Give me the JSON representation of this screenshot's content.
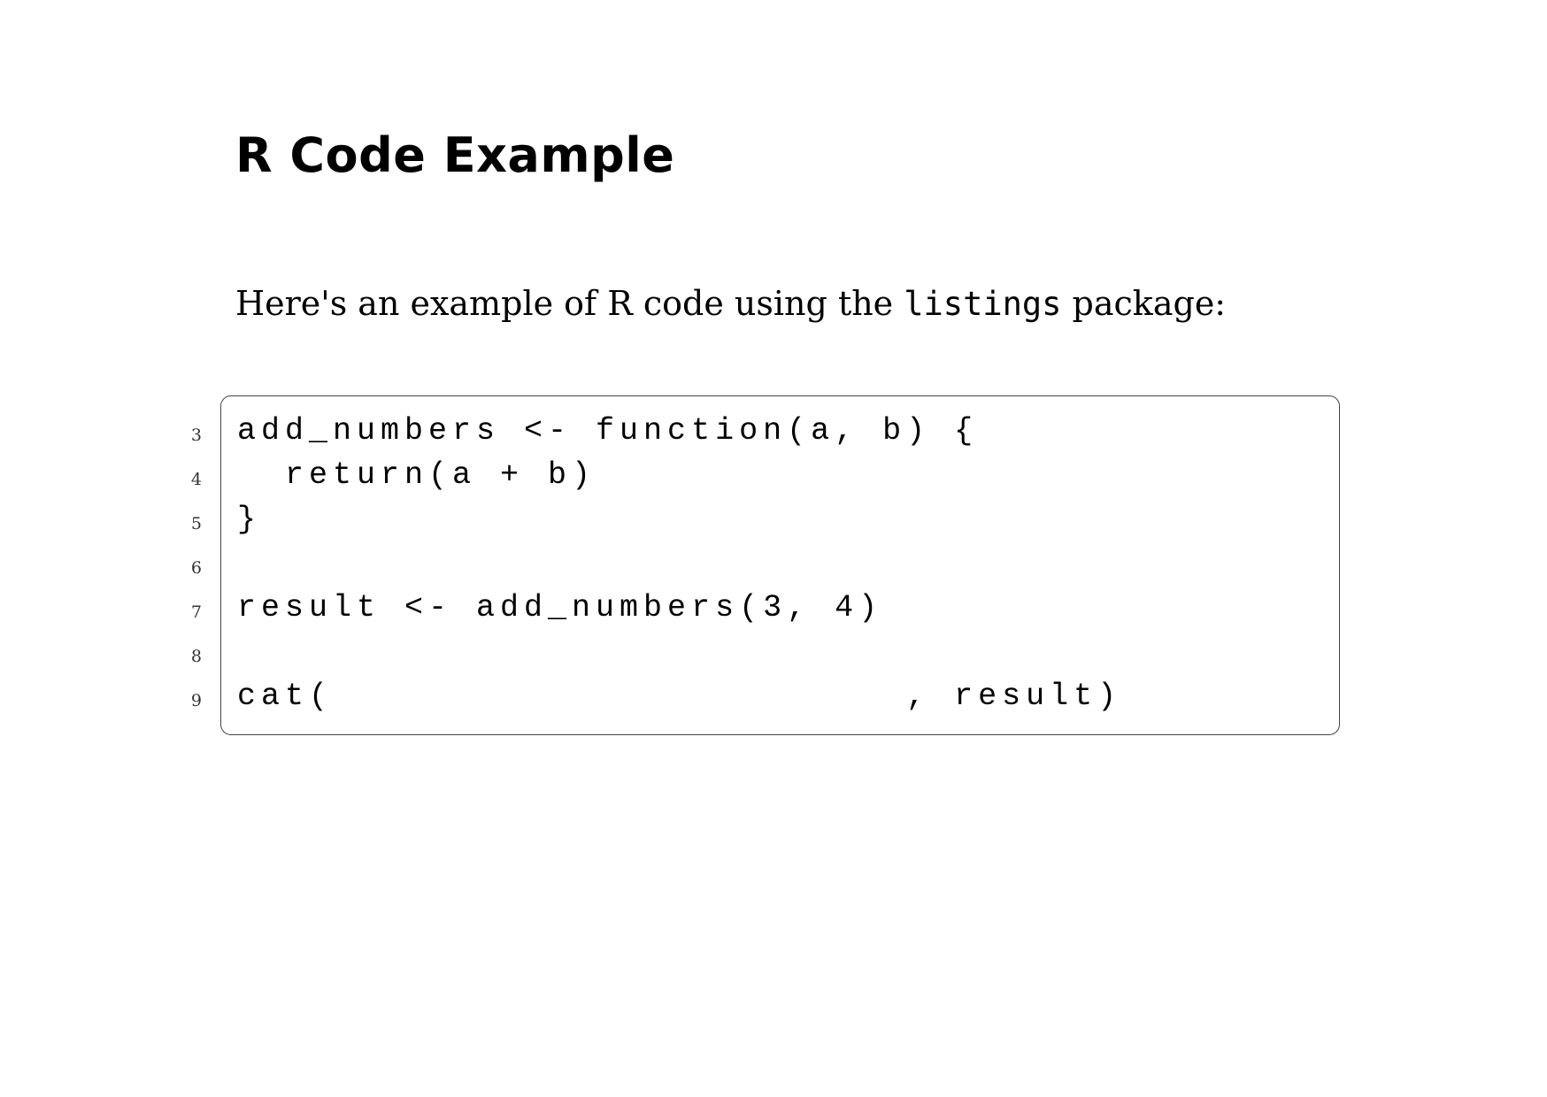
{
  "title": "R Code Example",
  "intro": {
    "before": "Here's an example of R code using the ",
    "package": "listings",
    "after": " package:"
  },
  "listing": {
    "line_numbers": [
      "3",
      "4",
      "5",
      "6",
      "7",
      "8",
      "9"
    ],
    "lines": [
      "add_numbers <- function(a, b) {",
      "  return(a + b)",
      "}",
      "",
      "result <- add_numbers(3, 4)",
      "",
      "cat(                        , result)"
    ]
  }
}
